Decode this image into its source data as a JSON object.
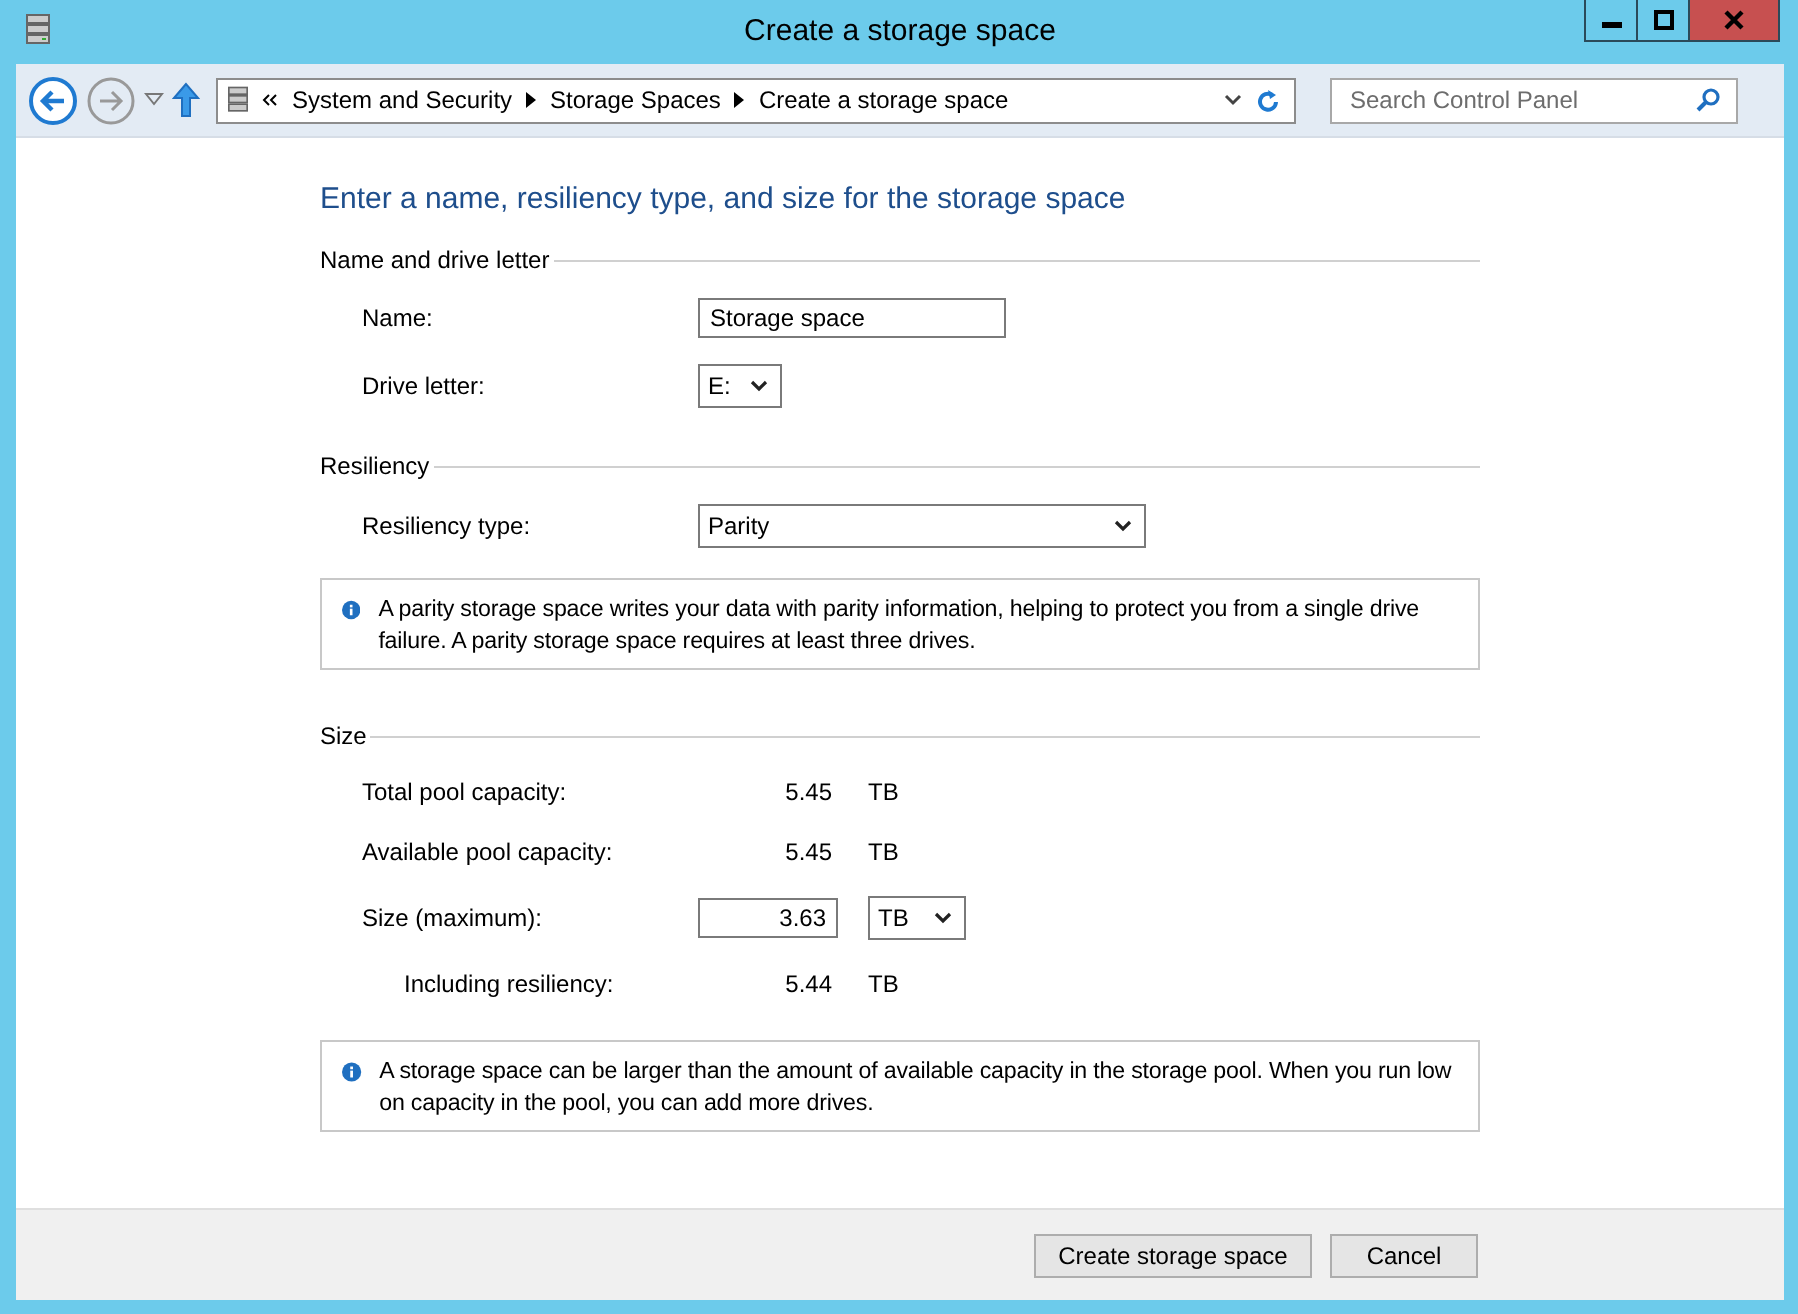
{
  "window": {
    "title": "Create a storage space"
  },
  "nav": {
    "breadcrumb": [
      "System and Security",
      "Storage Spaces",
      "Create a storage space"
    ],
    "search_placeholder": "Search Control Panel"
  },
  "heading": "Enter a name, resiliency type, and size for the storage space",
  "name_section": {
    "title": "Name and drive letter",
    "name_label": "Name:",
    "name_value": "Storage space",
    "drive_label": "Drive letter:",
    "drive_value": "E:"
  },
  "resiliency_section": {
    "title": "Resiliency",
    "type_label": "Resiliency type:",
    "type_value": "Parity",
    "info": "A parity storage space writes your data with parity information, helping to protect you from a single drive failure. A parity storage space requires at least three drives."
  },
  "size_section": {
    "title": "Size",
    "rows": [
      {
        "kind": "reading",
        "label": "Total pool capacity:",
        "value": "5.45",
        "unit": "TB"
      },
      {
        "kind": "reading",
        "label": "Available pool capacity:",
        "value": "5.45",
        "unit": "TB"
      },
      {
        "kind": "input",
        "label": "Size (maximum):",
        "value": "3.63",
        "unit": "TB"
      },
      {
        "kind": "subreading",
        "label": "Including resiliency:",
        "value": "5.44",
        "unit": "TB"
      }
    ],
    "info": "A storage space can be larger than the amount of available capacity in the storage pool. When you run low on capacity in the pool, you can add more drives."
  },
  "buttons": [
    "Create storage space",
    "Cancel"
  ]
}
